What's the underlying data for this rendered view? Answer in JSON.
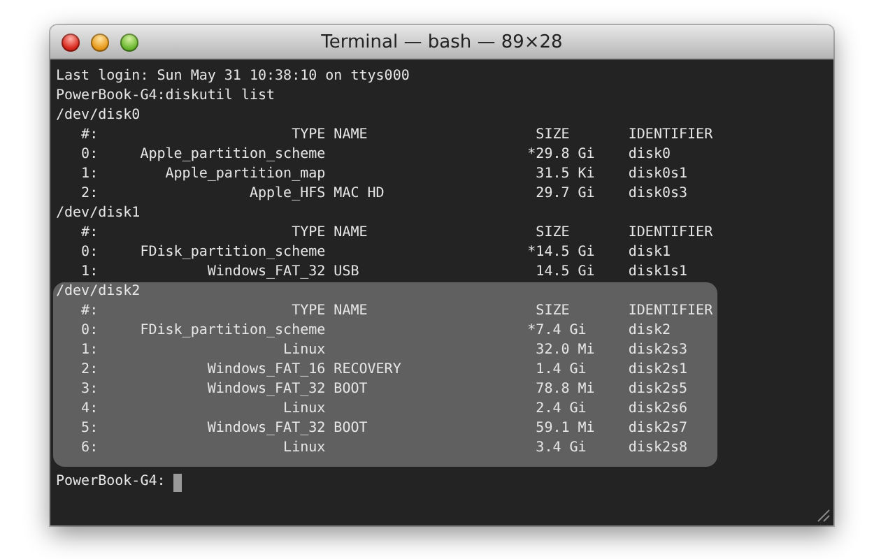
{
  "window": {
    "title": "Terminal — bash — 89×28"
  },
  "terminal": {
    "blocks": [
      {
        "selected": false,
        "lines": [
          "Last login: Sun May 31 10:38:10 on ttys000",
          "PowerBook-G4:diskutil list",
          "/dev/disk0",
          "   #:                       TYPE NAME                    SIZE       IDENTIFIER",
          "   0:     Apple_partition_scheme                        *29.8 Gi    disk0",
          "   1:        Apple_partition_map                         31.5 Ki    disk0s1",
          "   2:                  Apple_HFS MAC HD                  29.7 Gi    disk0s3",
          "/dev/disk1",
          "   #:                       TYPE NAME                    SIZE       IDENTIFIER",
          "   0:     FDisk_partition_scheme                        *14.5 Gi    disk1",
          "   1:             Windows_FAT_32 USB                     14.5 Gi    disk1s1"
        ]
      },
      {
        "selected": true,
        "lines": [
          "/dev/disk2",
          "   #:                       TYPE NAME                    SIZE       IDENTIFIER",
          "   0:     FDisk_partition_scheme                        *7.4 Gi     disk2",
          "   1:                      Linux                         32.0 Mi    disk2s3",
          "   2:             Windows_FAT_16 RECOVERY                1.4 Gi     disk2s1",
          "   3:             Windows_FAT_32 BOOT                    78.8 Mi    disk2s5",
          "   4:                      Linux                         2.4 Gi     disk2s6",
          "   5:             Windows_FAT_32 BOOT                    59.1 Mi    disk2s7",
          "   6:                      Linux                         3.4 Gi     disk2s8"
        ]
      }
    ],
    "prompt": "PowerBook-G4:",
    "cursor": true
  }
}
